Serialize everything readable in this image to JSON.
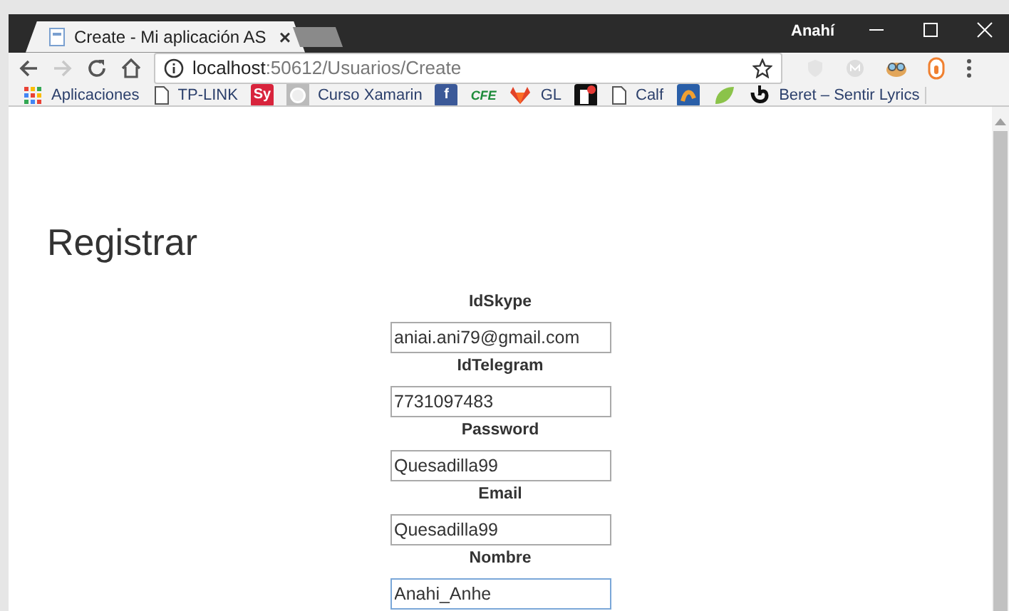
{
  "window": {
    "user": "Anahí"
  },
  "tab": {
    "title": "Create - Mi aplicación AS",
    "close": "×"
  },
  "address": {
    "host": "localhost",
    "path": ":50612/Usuarios/Create"
  },
  "nav": {
    "back_disabled": false,
    "forward_disabled": true
  },
  "bookmarks": [
    {
      "kind": "apps",
      "label": "Aplicaciones"
    },
    {
      "kind": "page",
      "label": "TP-LINK"
    },
    {
      "kind": "badge",
      "badge": "Sy",
      "color": "#d8243c"
    },
    {
      "kind": "ring",
      "label": "Curso Xamarin"
    },
    {
      "kind": "badge",
      "badge": "f",
      "color": "#3b5998"
    },
    {
      "kind": "wordmark",
      "label": "CFE"
    },
    {
      "kind": "fox",
      "label": "GL"
    },
    {
      "kind": "tile"
    },
    {
      "kind": "page",
      "label": "Calf"
    },
    {
      "kind": "square"
    },
    {
      "kind": "leaf"
    },
    {
      "kind": "swirl",
      "label": "Beret – Sentir Lyrics"
    }
  ],
  "page": {
    "heading": "Registrar",
    "fields": [
      {
        "label": "IdSkype",
        "value": "aniai.ani79@gmail.com",
        "focused": false
      },
      {
        "label": "IdTelegram",
        "value": "7731097483",
        "focused": false
      },
      {
        "label": "Password",
        "value": "Quesadilla99",
        "focused": false
      },
      {
        "label": "Email",
        "value": "Quesadilla99",
        "focused": false
      },
      {
        "label": "Nombre",
        "value": "Anahi_Anhe",
        "focused": true
      }
    ]
  }
}
